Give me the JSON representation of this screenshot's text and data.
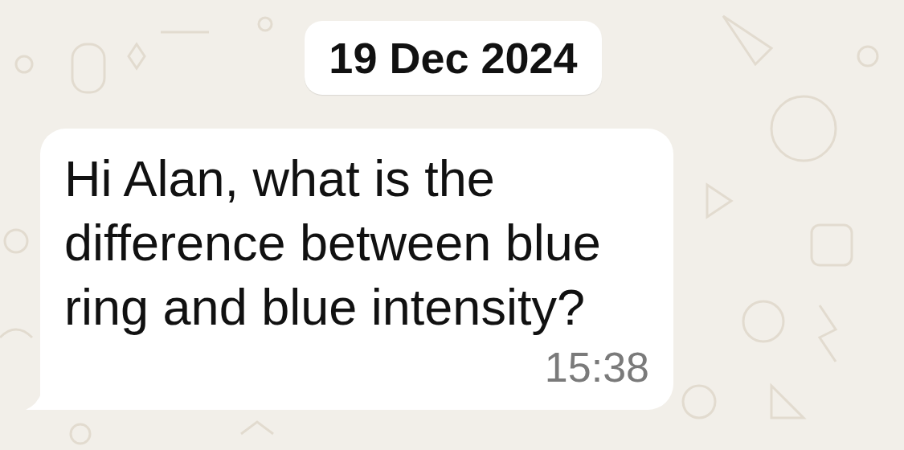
{
  "date_separator": "19 Dec 2024",
  "messages": [
    {
      "text": "Hi Alan, what is the difference between blue ring and blue intensity?",
      "time": "15:38"
    }
  ]
}
